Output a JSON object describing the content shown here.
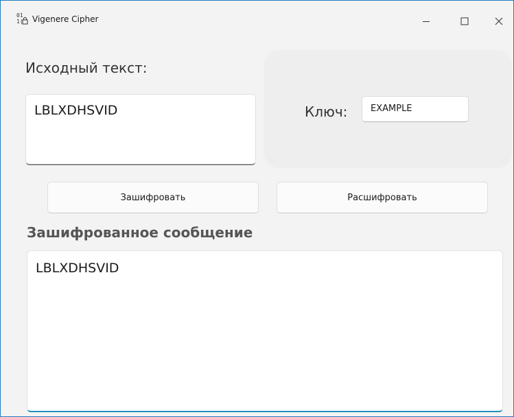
{
  "window": {
    "title": "Vigenere Cipher",
    "app_icon": "binary-lock-icon",
    "controls": {
      "minimize_icon": "minimize-icon",
      "maximize_icon": "maximize-icon",
      "close_icon": "close-icon"
    }
  },
  "source": {
    "label": "Исходный текст:",
    "value": "LBLXDHSVID"
  },
  "key": {
    "label": "Ключ:",
    "value": "EXAMPLE"
  },
  "actions": {
    "encrypt_label": "Зашифровать",
    "decrypt_label": "Расшифровать"
  },
  "result": {
    "label": "Зашифрованное сообщение",
    "value": "LBLXDHSVID"
  },
  "colors": {
    "window_border": "#1f7bbf",
    "accent": "#1f8fbf",
    "background": "#f3f3f3"
  }
}
